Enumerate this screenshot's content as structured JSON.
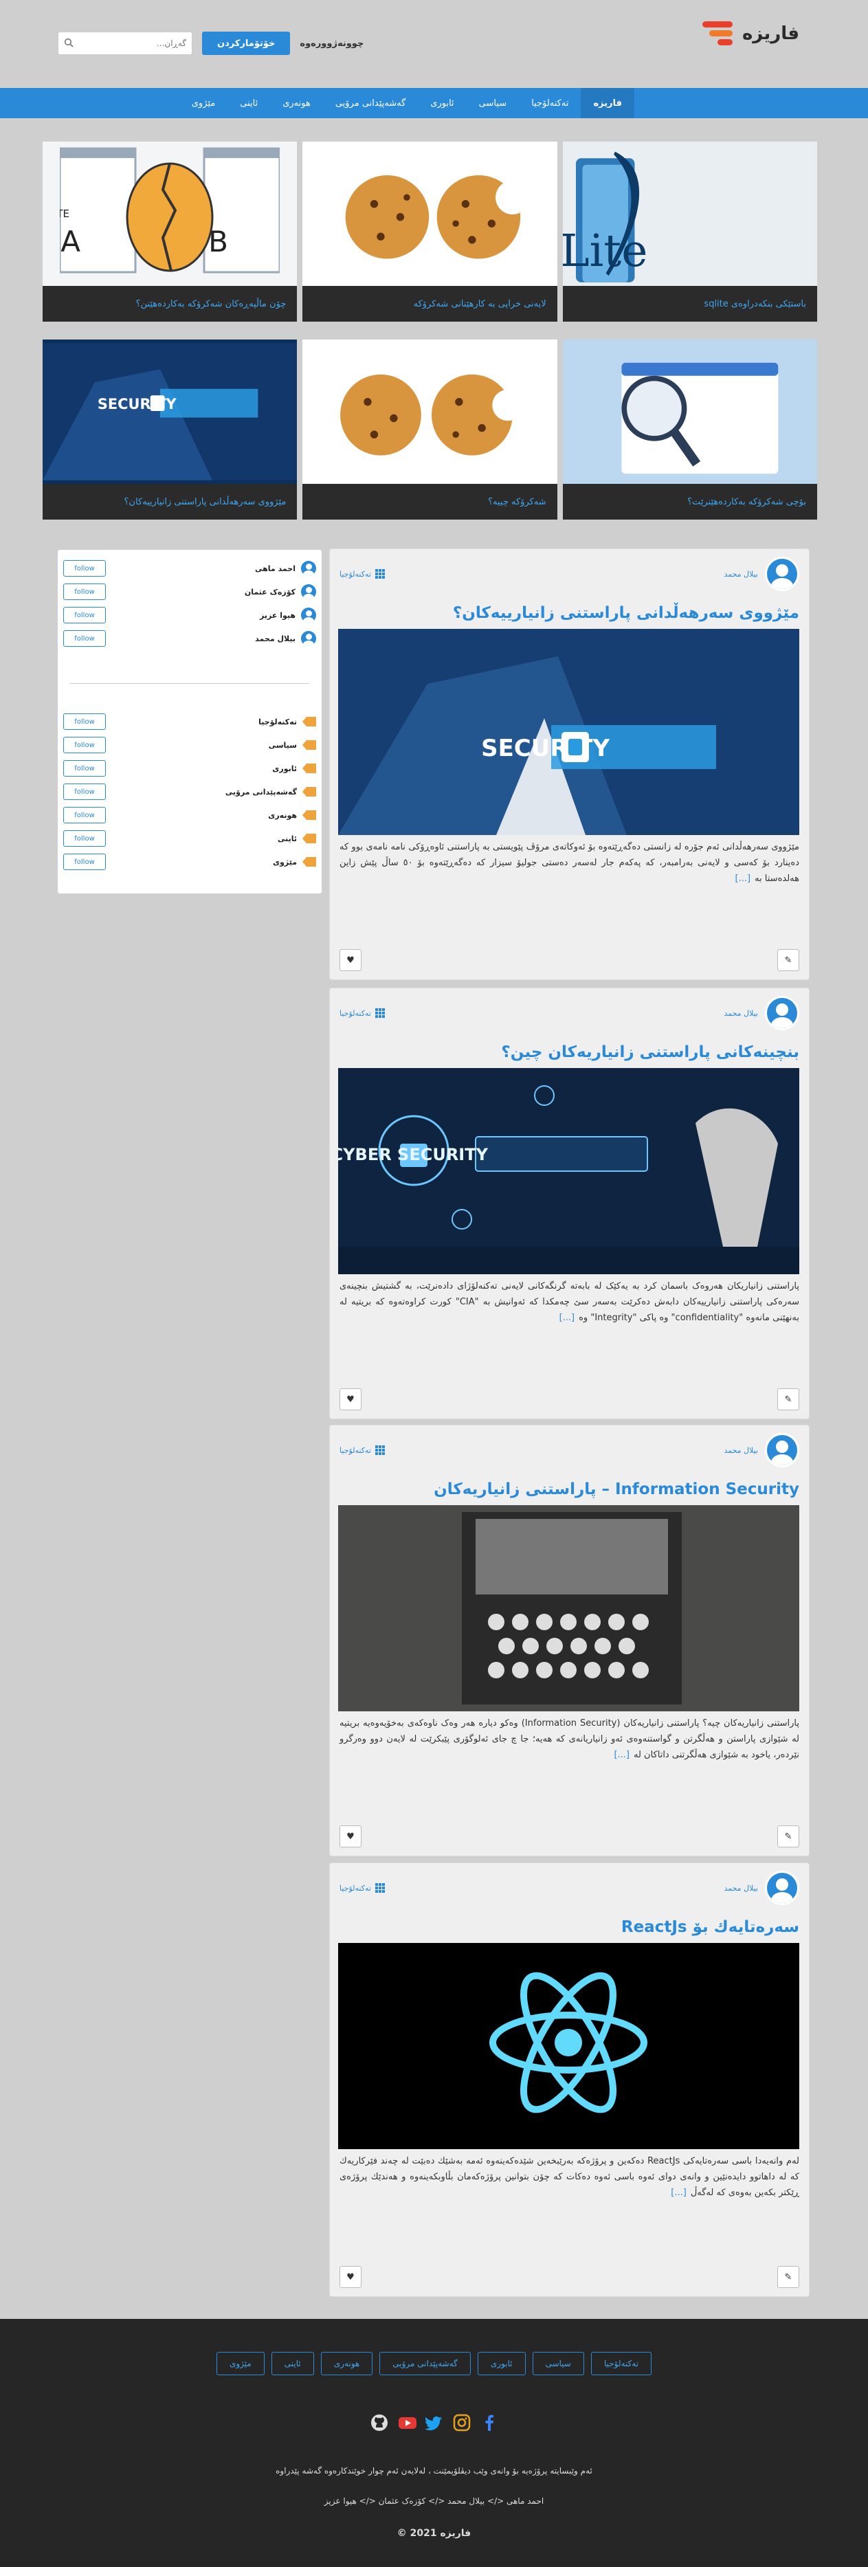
{
  "header": {
    "logo_text": "فاریزە",
    "login_label": "چوونەژوورەوە",
    "signup_label": "خۆتۆمارکردن",
    "search_placeholder": "گەڕان..."
  },
  "nav": {
    "items": [
      "فاریزە",
      "تەکنەلۆجیا",
      "سیاسی",
      "ئابوری",
      "گەشەپێدانی مرۆیی",
      "هونەری",
      "ئاینی",
      "مێژوی"
    ]
  },
  "featured": [
    {
      "caption": "باستێکی بنکەدراوەی sqlite"
    },
    {
      "caption": "لایەنی خراپی بە کارهێنانی شەکرۆکە"
    },
    {
      "caption": "چۆن ماڵپەڕەکان شەکرۆکە بەکاردەهێنن؟"
    },
    {
      "caption": "بۆچی شەکرۆکە بەکاردەهێنرێت؟"
    },
    {
      "caption": "شەکرۆکە چییە؟"
    },
    {
      "caption": "مێژووی سەرهەڵدانی پاراستنی زانیارییەکان؟"
    }
  ],
  "sidebar": {
    "users": [
      "احمد ماهی",
      "کۆزەک عثمان",
      "هیوا عزیز",
      "بیلال محمد"
    ],
    "categories": [
      "تەکنەلۆجیا",
      "سیاسی",
      "ئابوری",
      "گەشەپێدانی مرۆیی",
      "هونەری",
      "ئاینی",
      "مێژوی"
    ],
    "follow_label": "follow"
  },
  "posts": [
    {
      "author": "بیلال محمد",
      "category": "تەکنەلۆجیا",
      "title": "مێژووی سەرهەڵدانی پاراستنی زانیارییەکان؟",
      "excerpt": "مێژووی سەرهەڵدانی ئەم جۆرە لە زانستی دەگەڕێتەوە بۆ ئەوکاتەی مرۆڤ پێویستی بە پاراستنی ئاوەڕۆکی نامە نامەی بوو کە دەینارد بۆ کەسی و لایەنی بەرامبەر، کە پەکەم جار لەسەر دەستی جولیۆ سیزار کە دەگەڕێتەوە بۆ ٥٠ ساڵ پێش زاین هەلدەستا بە",
      "more": "[...]"
    },
    {
      "author": "بیلال محمد",
      "category": "تەکنەلۆجیا",
      "title": "بنچینەکانی پاراستنی زانیاریەکان چین؟",
      "excerpt": "پاراستنی زانیاریکان هەروەک باسمان کرد بە یەکێک لە بابەتە گرنگەکانی لایەنی تەکنەلۆژای دادەنرێت، بە گشتیش بنچینەی سەرەکی پاراستنی زانیارییەکان دابەش دەکرێت بەسەر سێ چەمکدا کە ئەوانیش بە \"CIA\" کورت کراوەتەوە کە بریتیە لە بەنهێنی مانەوە \"confidentiality\" وە پاکی \"Integrity\" وە",
      "more": "[...]"
    },
    {
      "author": "بیلال محمد",
      "category": "تەکنەلۆجیا",
      "title": "Information Security – پاراستنی زانیاریەکان",
      "excerpt": "پاراستنی زانیاریەکان چیە؟ پاراستنی زانیاریەکان (Information Security) وەکو دیارە هەر وەک ناوەکەی بەخۆیەوەیە بریتیە لە شێوازی پاراستن و هەڵگرتن و گواستنەوەی ئەو زانیاریانەی کە هەیە؛ جا چ جای ئەلوگۆری پێبکرێت لە لایەن دوو وەرگرو نێردەر، یاخود بە شێوازی هەڵگرتنی داتاکان لە",
      "more": "[...]"
    },
    {
      "author": "بیلال محمد",
      "category": "تەکنەلۆجیا",
      "title": "سەرەتایەك بۆ ReactJs",
      "excerpt": "لەم وانەیەدا باسی سەرەتایەکی ReactJs دەکەین و پرۆژەکە بەرێبخەین شێدەکەینەوە ئەمە بەشێك دەبێت لە چەند فێرکاریەك کە لە داهاتوو دایدەنێین و وانەی دوای ئەوە باسی ئەوە دەکات کە چۆن بتوانین پرۆژەکەمان بڵاوبکەینەوە و هەندێك پرۆژەی ڕێکتر بکەین بەوەی کە لەگەڵ",
      "more": "[...]"
    }
  ],
  "footer": {
    "links": [
      "تەکنەلۆجیا",
      "سیاسی",
      "ئابوری",
      "گەشەپێدانی مرۆیی",
      "هونەری",
      "ئاینی",
      "مێژوی"
    ],
    "about": "ئەم وێبسایتە پرۆژەیە بۆ وانەی وێب دیڤلۆپمێنت ، لەلایەن ئەم چوار خوێندکارەوە گەشە پێدراوە",
    "developers": "احمد ماهی </> بیلال محمد </> کۆزەک عثمان </> هیوا عزیز",
    "copyright": "فاریزە 2021 ©",
    "colors": {
      "github": "#dddddd",
      "youtube": "#e53935",
      "twitter": "#1da1f2",
      "instagram": "#e6a01f",
      "facebook": "#3b82f6"
    }
  }
}
